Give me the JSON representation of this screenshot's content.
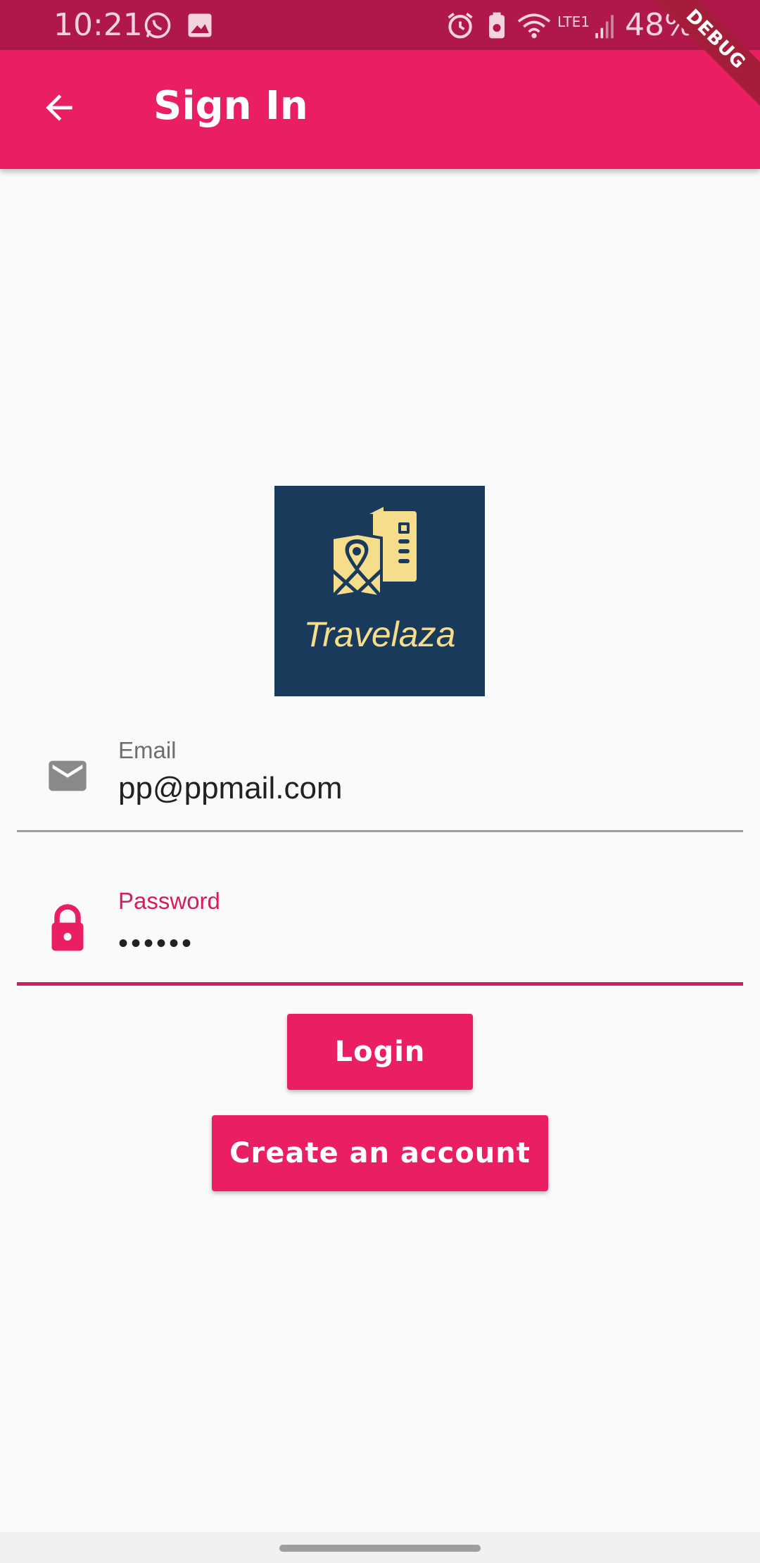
{
  "status_bar": {
    "time": "10:21",
    "battery": "48%",
    "network_label": "LTE1",
    "icons": [
      "whatsapp-icon",
      "gallery-icon",
      "alarm-icon",
      "battery-saver-icon",
      "wifi-icon",
      "signal-icon",
      "battery-icon"
    ]
  },
  "debug_banner": "DEBUG",
  "app_bar": {
    "title": "Sign In",
    "back_icon": "arrow-back-icon",
    "background": "#e91e63"
  },
  "logo": {
    "text": "Travelaza",
    "background": "#1a3a5c",
    "accent": "#f5dd8c"
  },
  "form": {
    "email": {
      "label": "Email",
      "value": "pp@ppmail.com",
      "icon": "mail-icon"
    },
    "password": {
      "label": "Password",
      "value": "••••••",
      "icon": "lock-icon",
      "accent": "#d81b60"
    }
  },
  "buttons": {
    "login": "Login",
    "create_account": "Create an account"
  }
}
